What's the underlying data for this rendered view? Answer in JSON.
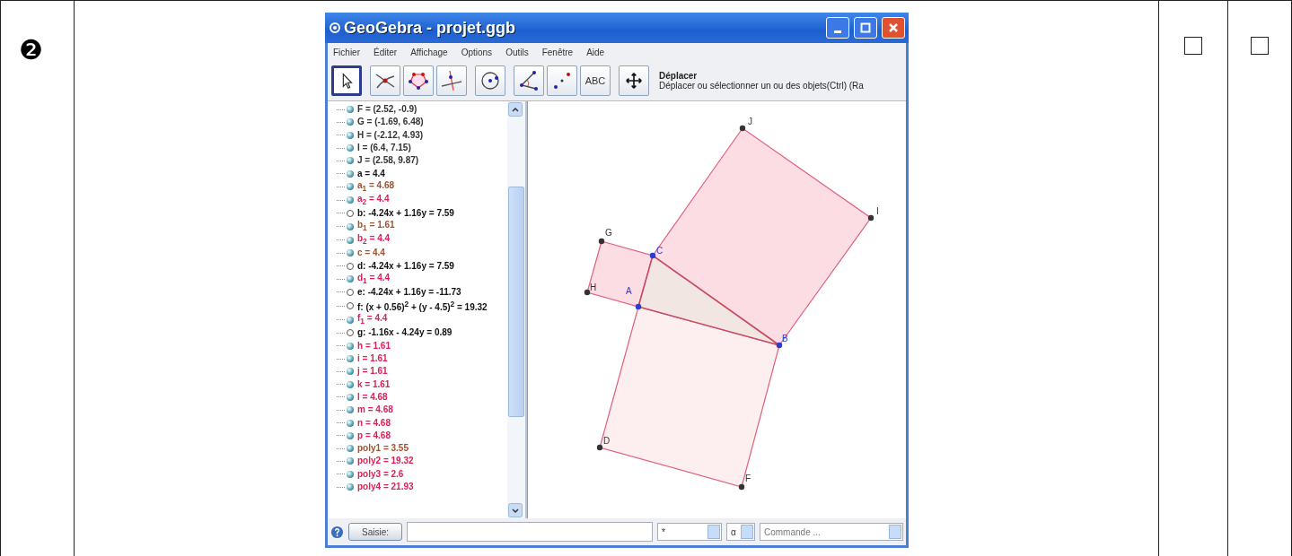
{
  "row": {
    "number": "❷",
    "checkboxes": [
      {
        "checked": false
      },
      {
        "checked": false
      }
    ]
  },
  "window": {
    "title": "GeoGebra - projet.ggb"
  },
  "menu": [
    "Fichier",
    "Éditer",
    "Affichage",
    "Options",
    "Outils",
    "Fenêtre",
    "Aide"
  ],
  "toolbar": {
    "tools": [
      {
        "kind": "pointer",
        "selected": true
      },
      {
        "kind": "intersect",
        "selected": false
      },
      {
        "kind": "polygon",
        "selected": false
      },
      {
        "kind": "perpendicular",
        "selected": false
      },
      {
        "kind": "circle",
        "selected": false
      },
      {
        "kind": "angle",
        "selected": false
      },
      {
        "kind": "reflect",
        "selected": false
      },
      {
        "kind": "text",
        "label": "ABC",
        "selected": false
      },
      {
        "kind": "move",
        "selected": false
      }
    ],
    "tool_name": "Déplacer",
    "tool_help": "Déplacer ou sélectionner un ou des objets(Ctrl) (Ra"
  },
  "algebra": [
    {
      "text": "F = (2.52, -0.9)",
      "visible": true,
      "color": "#333333"
    },
    {
      "text": "G = (-1.69, 6.48)",
      "visible": true,
      "color": "#333333"
    },
    {
      "text": "H = (-2.12, 4.93)",
      "visible": true,
      "color": "#333333"
    },
    {
      "text": "I = (6.4, 7.15)",
      "visible": true,
      "color": "#333333"
    },
    {
      "text": "J = (2.58, 9.87)",
      "visible": true,
      "color": "#333333"
    },
    {
      "text": "a = 4.4",
      "visible": true,
      "color": "#111111"
    },
    {
      "text": "a$_{1}$ = 4.68",
      "visible": true,
      "color": "#a0522d"
    },
    {
      "text": "a$_{2}$ = 4.4",
      "visible": true,
      "color": "#dc1f55"
    },
    {
      "text": "b: -4.24x + 1.16y = 7.59",
      "visible": false,
      "color": "#111111"
    },
    {
      "text": "b$_{1}$ = 1.61",
      "visible": true,
      "color": "#a0522d"
    },
    {
      "text": "b$_{2}$ = 4.4",
      "visible": true,
      "color": "#dc1f55"
    },
    {
      "text": "c = 4.4",
      "visible": true,
      "color": "#a0522d"
    },
    {
      "text": "d: -4.24x + 1.16y = 7.59",
      "visible": false,
      "color": "#111111"
    },
    {
      "text": "d$_{1}$ = 4.4",
      "visible": true,
      "color": "#dc1f55"
    },
    {
      "text": "e: -4.24x + 1.16y = -11.73",
      "visible": false,
      "color": "#111111"
    },
    {
      "text": "f: (x + 0.56)$^{2}$ + (y - 4.5)$^{2}$ = 19.32",
      "visible": false,
      "color": "#111111"
    },
    {
      "text": "f$_{1}$ = 4.4",
      "visible": true,
      "color": "#dc1f55"
    },
    {
      "text": "g: -1.16x - 4.24y = 0.89",
      "visible": false,
      "color": "#111111"
    },
    {
      "text": "h = 1.61",
      "visible": true,
      "color": "#dc1f55"
    },
    {
      "text": "i = 1.61",
      "visible": true,
      "color": "#dc1f55"
    },
    {
      "text": "j = 1.61",
      "visible": true,
      "color": "#dc1f55"
    },
    {
      "text": "k = 1.61",
      "visible": true,
      "color": "#dc1f55"
    },
    {
      "text": "l = 4.68",
      "visible": true,
      "color": "#dc1f55"
    },
    {
      "text": "m = 4.68",
      "visible": true,
      "color": "#dc1f55"
    },
    {
      "text": "n = 4.68",
      "visible": true,
      "color": "#dc1f55"
    },
    {
      "text": "p = 4.68",
      "visible": true,
      "color": "#dc1f55"
    },
    {
      "text": "poly1 = 3.55",
      "visible": true,
      "color": "#a0522d"
    },
    {
      "text": "poly2 = 19.32",
      "visible": true,
      "color": "#dc1f55"
    },
    {
      "text": "poly3 = 2.6",
      "visible": true,
      "color": "#dc1f55"
    },
    {
      "text": "poly4 = 21.93",
      "visible": true,
      "color": "#dc1f55"
    }
  ],
  "graphics": {
    "points": [
      {
        "label": "J",
        "color": "#333333"
      },
      {
        "label": "I",
        "color": "#333333"
      },
      {
        "label": "G",
        "color": "#333333"
      },
      {
        "label": "C",
        "color": "#2b3bd6"
      },
      {
        "label": "H",
        "color": "#333333"
      },
      {
        "label": "A",
        "color": "#2b3bd6"
      },
      {
        "label": "B",
        "color": "#2b3bd6"
      },
      {
        "label": "D",
        "color": "#333333"
      },
      {
        "label": "F",
        "color": "#333333"
      }
    ]
  },
  "input_bar": {
    "button": "Saisie:",
    "symbol": "*",
    "greek": "α",
    "command": "Commande ..."
  }
}
